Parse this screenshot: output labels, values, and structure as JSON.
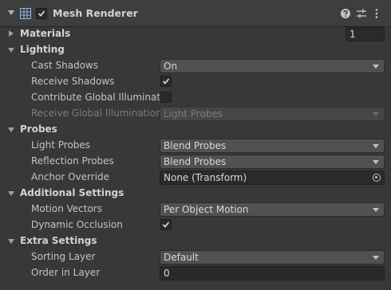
{
  "header": {
    "title": "Mesh Renderer",
    "enabled": true
  },
  "materials": {
    "label": "Materials",
    "count": "1"
  },
  "lighting": {
    "label": "Lighting",
    "cast_shadows": {
      "label": "Cast Shadows",
      "value": "On"
    },
    "receive_shadows": {
      "label": "Receive Shadows",
      "checked": true
    },
    "contribute_gi": {
      "label": "Contribute Global Illumination",
      "checked": false
    },
    "receive_gi": {
      "label": "Receive Global Illumination",
      "value": "Light Probes"
    }
  },
  "probes": {
    "label": "Probes",
    "light_probes": {
      "label": "Light Probes",
      "value": "Blend Probes"
    },
    "reflection_probes": {
      "label": "Reflection Probes",
      "value": "Blend Probes"
    },
    "anchor_override": {
      "label": "Anchor Override",
      "value": "None (Transform)"
    }
  },
  "additional": {
    "label": "Additional Settings",
    "motion_vectors": {
      "label": "Motion Vectors",
      "value": "Per Object Motion"
    },
    "dynamic_occlusion": {
      "label": "Dynamic Occlusion",
      "checked": true
    }
  },
  "extra": {
    "label": "Extra Settings",
    "sorting_layer": {
      "label": "Sorting Layer",
      "value": "Default"
    },
    "order_in_layer": {
      "label": "Order in Layer",
      "value": "0"
    }
  },
  "colors": {
    "background": "#383838",
    "header": "#3e3e3e",
    "dropdown": "#515151",
    "field": "#2a2a2a"
  }
}
